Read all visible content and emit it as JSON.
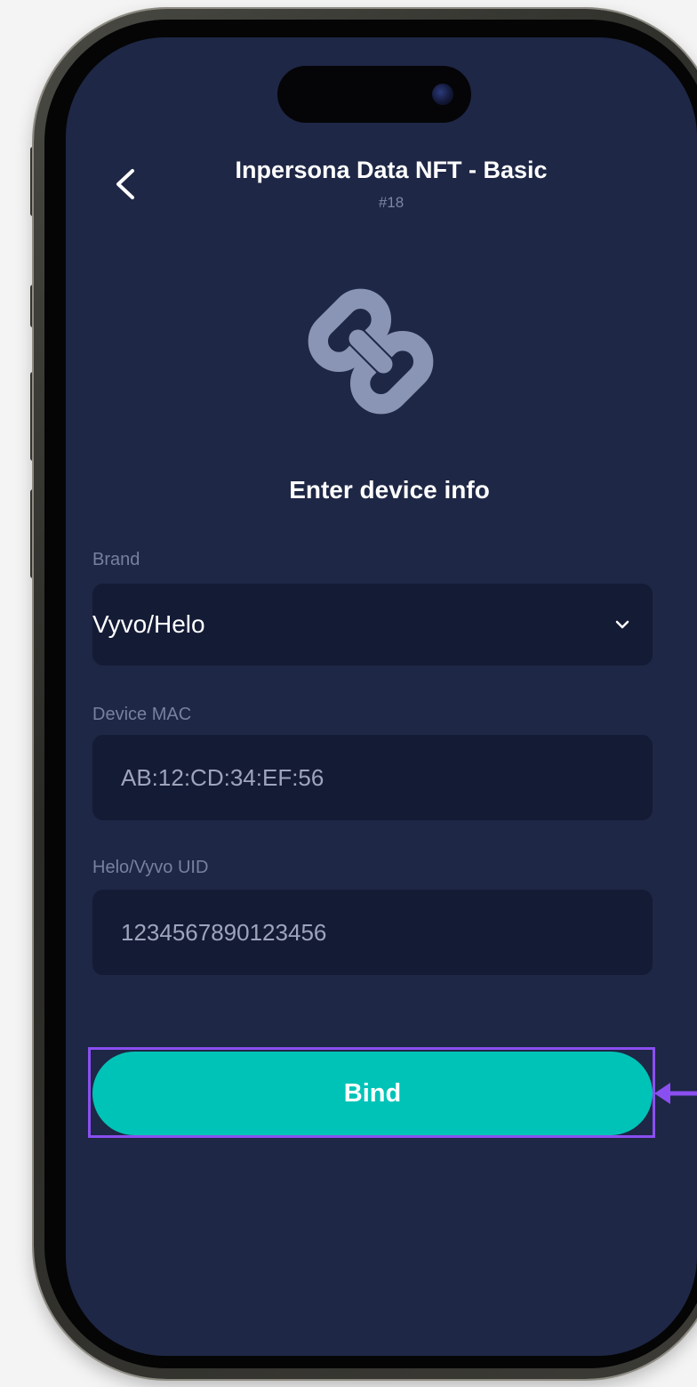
{
  "header": {
    "title": "Inpersona Data NFT - Basic",
    "subtitle": "#18"
  },
  "main": {
    "heading": "Enter device info",
    "brand": {
      "label": "Brand",
      "value": "Vyvo/Helo"
    },
    "device_mac": {
      "label": "Device MAC",
      "value": "AB:12:CD:34:EF:56"
    },
    "uid": {
      "label": "Helo/Vyvo UID",
      "value": "1234567890123456"
    },
    "bind_label": "Bind"
  },
  "icons": {
    "back": "chevron-left-icon",
    "link": "link-icon",
    "dropdown": "chevron-down-icon",
    "pointer": "arrow-left-icon"
  },
  "colors": {
    "screen_background": "#1e2745",
    "field_background": "#141b35",
    "accent": "#00c3b7",
    "highlight": "#8a4ff0"
  }
}
